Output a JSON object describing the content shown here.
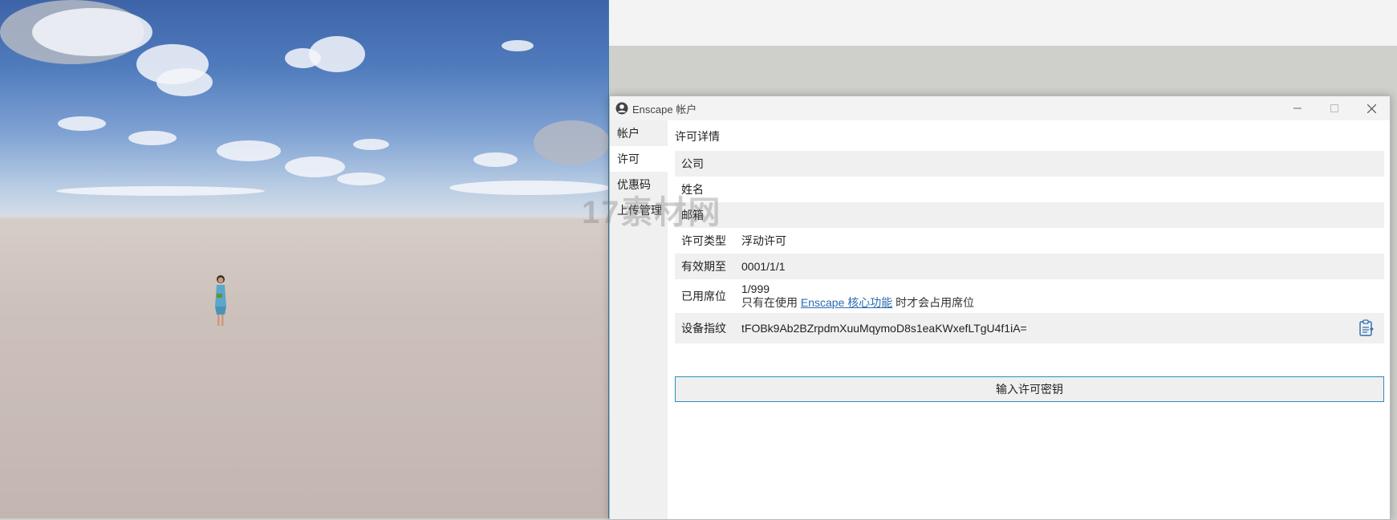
{
  "dialog": {
    "title": "Enscape 帐户",
    "minimize_icon": "minimize-icon",
    "maximize_icon": "maximize-icon",
    "close_icon": "close-icon"
  },
  "sidebar": {
    "items": [
      {
        "label": "帐户",
        "active": false
      },
      {
        "label": "许可",
        "active": true
      },
      {
        "label": "优惠码",
        "active": false
      },
      {
        "label": "上传管理",
        "active": false
      }
    ]
  },
  "license": {
    "section_title": "许可详情",
    "rows": {
      "company": {
        "label": "公司",
        "value": ""
      },
      "name": {
        "label": "姓名",
        "value": ""
      },
      "email": {
        "label": "邮箱",
        "value": ""
      },
      "license_type": {
        "label": "许可类型",
        "value": "浮动许可"
      },
      "valid_until": {
        "label": "有效期至",
        "value": "0001/1/1"
      },
      "seats": {
        "label": "已用席位",
        "value": "1/999",
        "note_prefix": "只有在使用 ",
        "note_link": "Enscape 核心功能",
        "note_suffix": " 时才会占用席位"
      },
      "fingerprint": {
        "label": "设备指纹",
        "value": "tFOBk9Ab2BZrpdmXuuMqymoD8s1eaKWxefLTgU4f1iA=",
        "copy_icon": "clipboard-icon"
      }
    },
    "enter_key_button": "输入许可密钥"
  },
  "watermark": {
    "text": "17素材网"
  },
  "colors": {
    "accent": "#2a8fbd",
    "link": "#2b6cb0",
    "row_shade": "#f0f0f0"
  }
}
